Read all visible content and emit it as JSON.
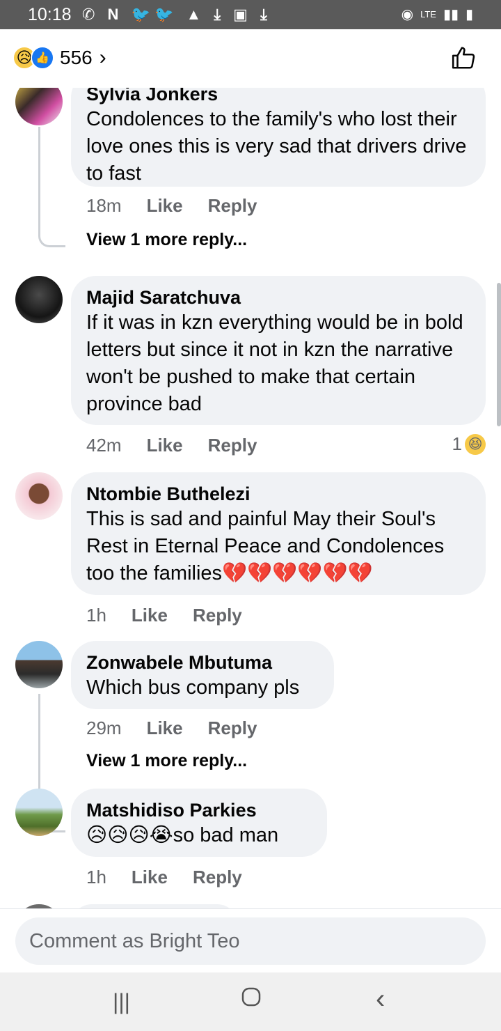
{
  "status_bar": {
    "time": "10:18",
    "network": "LTE"
  },
  "top_bar": {
    "reaction_count": "556"
  },
  "comments": [
    {
      "name": "Sylvia Jonkers",
      "text": "Condolences to the family's who lost their love ones this is very sad that drivers drive to fast",
      "time": "18m",
      "like": "Like",
      "reply": "Reply",
      "more_replies": "View 1 more reply..."
    },
    {
      "name": "Majid Saratchuva",
      "text": "If it was in kzn everything would be in bold letters but since it not in kzn the narrative won't be pushed to make that certain province bad",
      "time": "42m",
      "like": "Like",
      "reply": "Reply",
      "reactions": "1"
    },
    {
      "name": "Ntombie Buthelezi",
      "text": "This is sad and painful May their Soul's Rest in Eternal Peace and Condolences too the families💔💔💔💔💔💔",
      "time": "1h",
      "like": "Like",
      "reply": "Reply"
    },
    {
      "name": "Zonwabele Mbutuma",
      "text": "Which bus company pls",
      "time": "29m",
      "like": "Like",
      "reply": "Reply",
      "more_replies": "View 1 more reply..."
    },
    {
      "name": "Matshidiso Parkies",
      "text": "😥😥😥😭so bad man",
      "time": "1h",
      "like": "Like",
      "reply": "Reply"
    }
  ],
  "comment_box": {
    "placeholder": "Comment as Bright Teo"
  },
  "icons": {
    "reaction_sad": "sad-face-icon",
    "reaction_like": "thumbs-up-icon",
    "reaction_haha": "laughing-face-icon",
    "nav_recent": "recent-apps-icon",
    "nav_home": "home-icon",
    "nav_back": "back-icon"
  },
  "colors": {
    "brand": "#1877f2",
    "bubble": "#f0f2f5",
    "muted": "#65676b"
  }
}
